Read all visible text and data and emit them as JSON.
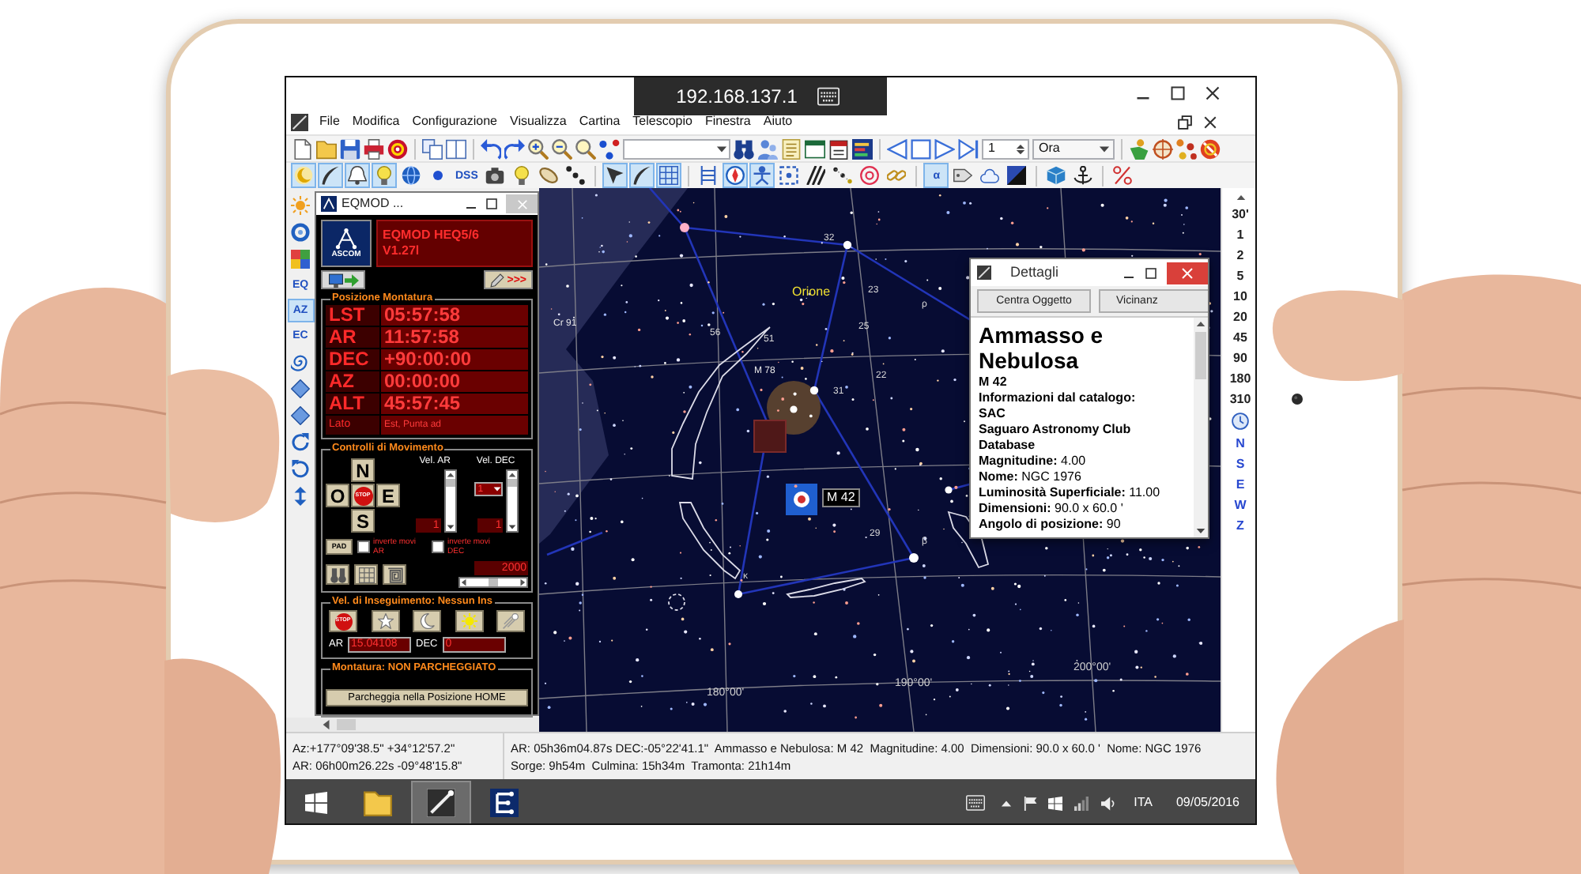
{
  "remote_bar": {
    "address": "192.168.137.1"
  },
  "menu": [
    "File",
    "Modifica",
    "Configurazione",
    "Visualizza",
    "Cartina",
    "Telescopio",
    "Finestra",
    "Aiuto"
  ],
  "toolbar_2": {
    "spin_value": "1",
    "time_mode": "Ora"
  },
  "toolbar_3": [
    {
      "pressed": true
    },
    {
      "pressed": true
    },
    {
      "pressed": true
    },
    {
      "pressed": true
    },
    {
      "pressed": false
    },
    {
      "pressed": false
    },
    {
      "label": "DSS",
      "pressed": false
    },
    {
      "pressed": false
    },
    {
      "pressed": false
    },
    {
      "pressed": false
    },
    {
      "pressed": false
    },
    {
      "pressed": true
    },
    {
      "pressed": true
    },
    {
      "pressed": true
    },
    {
      "pressed": false
    },
    {
      "pressed": true
    },
    {
      "pressed": true
    },
    {
      "pressed": false
    },
    {
      "pressed": false
    },
    {
      "pressed": false
    },
    {
      "pressed": false
    },
    {
      "pressed": false
    },
    {
      "label": "α",
      "pressed": true
    },
    {
      "pressed": false
    },
    {
      "pressed": false
    },
    {
      "pressed": false
    },
    {
      "pressed": false
    },
    {
      "pressed": false
    },
    {
      "pressed": false
    }
  ],
  "view_toolbar": [
    {
      "pressed": false
    },
    {
      "pressed": false
    },
    {
      "pressed": false
    },
    {
      "label": "EQ",
      "pressed": false
    },
    {
      "label": "AZ",
      "pressed": true
    },
    {
      "label": "EC",
      "pressed": false
    },
    {
      "pressed": false
    },
    {
      "pressed": false
    },
    {
      "pressed": false
    },
    {
      "pressed": false
    },
    {
      "pressed": false
    },
    {
      "pressed": false
    }
  ],
  "eqmod": {
    "title": "EQMOD ...",
    "logo": "ASCOM",
    "header": [
      "EQMOD HEQ5/6",
      "V1.27l"
    ],
    "expand": ">>>",
    "position_group": "Posizione Montatura",
    "position": [
      {
        "label": "LST",
        "value": "05:57:58",
        "kind": "reading"
      },
      {
        "label": "AR",
        "value": "11:57:58",
        "kind": "reading"
      },
      {
        "label": "DEC",
        "value": "+90:00:00",
        "kind": "reading"
      },
      {
        "label": "AZ",
        "value": "00:00:00",
        "kind": "reading"
      },
      {
        "label": "ALT",
        "value": "45:57:45",
        "kind": "reading"
      },
      {
        "label": "Lato",
        "value": "Est, Punta ad",
        "kind": "note"
      }
    ],
    "motion_group": "Controlli di Movimento",
    "pad": {
      "north": "N",
      "west": "O",
      "stop": "STOP",
      "east": "E",
      "south": "S"
    },
    "rates": [
      {
        "label": "Vel. AR",
        "value": "1"
      },
      {
        "label": "Vel. DEC",
        "value": "1"
      }
    ],
    "rate_preset": "1",
    "pad_button": "PAD",
    "reverse": [
      {
        "label": "inverte movi AR",
        "checked": false
      },
      {
        "label": "inverte movi DEC",
        "checked": false
      }
    ],
    "pulse": {
      "value": "2000"
    },
    "tracking_group": "Vel. di Inseguimento: Nessun Ins",
    "tracking_stop": "STOP",
    "tracking_rates": [
      {
        "label": "AR",
        "value": "15.04108"
      },
      {
        "label": "DEC",
        "value": "0"
      }
    ],
    "park_group": "Montatura: NON PARCHEGGIATO",
    "park_button": "Parcheggia nella Posizione HOME"
  },
  "sky_map": {
    "labels": [
      {
        "text": "Orione",
        "kind": "constellation"
      },
      {
        "text": "Cr 91",
        "kind": "object"
      },
      {
        "text": "32",
        "kind": "star"
      },
      {
        "text": "23",
        "kind": "star"
      },
      {
        "text": "25",
        "kind": "star"
      },
      {
        "text": "22",
        "kind": "star"
      },
      {
        "text": "31",
        "kind": "star"
      },
      {
        "text": "51",
        "kind": "star"
      },
      {
        "text": "56",
        "kind": "star"
      },
      {
        "text": "M 78",
        "kind": "object"
      },
      {
        "text": "M 42",
        "kind": "tag"
      },
      {
        "text": "29",
        "kind": "star"
      },
      {
        "text": "β",
        "kind": "star"
      },
      {
        "text": "κ",
        "kind": "star"
      },
      {
        "text": "ρ",
        "kind": "star"
      },
      {
        "text": "180°00'",
        "kind": "grid"
      },
      {
        "text": "190°00'",
        "kind": "grid"
      },
      {
        "text": "200°00'",
        "kind": "grid"
      }
    ]
  },
  "details": {
    "title": "Dettagli",
    "buttons": [
      "Centra Oggetto",
      "Vicinanz"
    ],
    "heading": "Ammasso e Nebulosa",
    "lines": [
      {
        "kind": "text",
        "text": "M 42"
      },
      {
        "kind": "text",
        "text": "Informazioni dal catalogo:"
      },
      {
        "kind": "text",
        "text": "SAC"
      },
      {
        "kind": "text",
        "text": "Saguaro Astronomy Club Database"
      },
      {
        "kind": "field",
        "label": "Magnitudine:",
        "value": "4.00"
      },
      {
        "kind": "field",
        "label": "Nome:",
        "value": "NGC 1976"
      },
      {
        "kind": "field",
        "label": "Luminosità Superficiale:",
        "value": "11.00"
      },
      {
        "kind": "field",
        "label": "Dimensioni:",
        "value": "90.0 x 60.0 '"
      },
      {
        "kind": "field",
        "label": "Angolo di posizione:",
        "value": "90"
      }
    ]
  },
  "zoom_scale": {
    "levels": [
      "30'",
      "1",
      "2",
      "5",
      "10",
      "20",
      "45",
      "90",
      "180",
      "310"
    ],
    "directions": [
      "N",
      "S",
      "E",
      "W",
      "Z"
    ]
  },
  "status_bar": {
    "pointer": [
      "Az:+177°09'38.5\" +34°12'57.2\"",
      "AR: 06h00m26.22s -09°48'15.8\""
    ],
    "object": [
      "AR: 05h36m04.87s DEC:-05°22'41.1\"  Ammasso e Nebulosa: M 42  Magnitudine: 4.00  Dimensioni: 90.0 x 60.0 '  Nome: NGC 1976",
      "Sorge: 9h54m  Culmina: 15h34m  Tramonta: 21h14m"
    ]
  },
  "taskbar": {
    "apps": [
      {
        "selected": false
      },
      {
        "selected": true
      },
      {
        "selected": false
      }
    ],
    "language": "ITA",
    "date": "09/05/2016"
  }
}
